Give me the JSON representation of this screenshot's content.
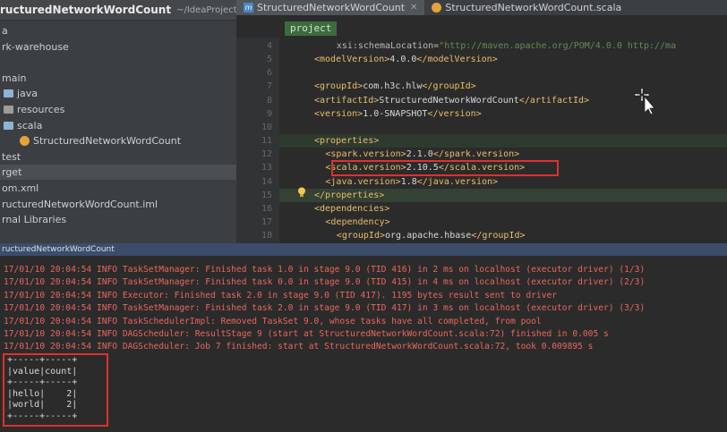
{
  "project": {
    "name": "ructuredNetworkWordCount",
    "path": "~/IdeaProjects/Stru",
    "items": [
      {
        "label": "a",
        "indent": 2
      },
      {
        "label": "rk-warehouse",
        "indent": 2
      },
      {
        "label": "",
        "indent": 2
      },
      {
        "label": "main",
        "indent": 2
      },
      {
        "label": "java",
        "indent": 4,
        "icon": "folder-icon"
      },
      {
        "label": "resources",
        "indent": 4,
        "icon": "resources-folder-icon"
      },
      {
        "label": "scala",
        "indent": 4,
        "icon": "folder-icon"
      },
      {
        "label": "StructuredNetworkWordCount",
        "indent": 22,
        "icon": "scala-object-icon"
      },
      {
        "label": "test",
        "indent": 2
      },
      {
        "label": "rget",
        "indent": 2,
        "selected": true
      },
      {
        "label": "om.xml",
        "indent": 2
      },
      {
        "label": "ructuredNetworkWordCount.iml",
        "indent": 2
      },
      {
        "label": "rnal Libraries",
        "indent": 2
      }
    ]
  },
  "tabs": [
    {
      "label": "StructuredNetworkWordCount",
      "icon": "maven-icon",
      "active": true
    },
    {
      "label": "StructuredNetworkWordCount.scala",
      "icon": "scala-file-icon",
      "active": false
    }
  ],
  "breadcrumb": "project",
  "code_lines": [
    {
      "num": "4",
      "indent": 4,
      "parts": [
        {
          "c": "attr",
          "t": "xsi:schemaLocation="
        },
        {
          "c": "str",
          "t": "\"http://maven.apache.org/POM/4.0.0 http://ma"
        }
      ]
    },
    {
      "num": "5",
      "indent": 0,
      "parts": [
        {
          "c": "tag",
          "t": "<modelVersion>"
        },
        {
          "c": "txt",
          "t": "4.0.0"
        },
        {
          "c": "tag",
          "t": "</modelVersion>"
        }
      ]
    },
    {
      "num": "6",
      "indent": 0,
      "parts": []
    },
    {
      "num": "7",
      "indent": 0,
      "parts": [
        {
          "c": "tag",
          "t": "<groupId>"
        },
        {
          "c": "txt",
          "t": "com.h3c.hlw"
        },
        {
          "c": "tag",
          "t": "</groupId>"
        }
      ]
    },
    {
      "num": "8",
      "indent": 0,
      "parts": [
        {
          "c": "tag",
          "t": "<artifactId>"
        },
        {
          "c": "txt",
          "t": "StructuredNetworkWordCount"
        },
        {
          "c": "tag",
          "t": "</artifactId>"
        }
      ]
    },
    {
      "num": "9",
      "indent": 0,
      "parts": [
        {
          "c": "tag",
          "t": "<version>"
        },
        {
          "c": "txt",
          "t": "1.0-SNAPSHOT"
        },
        {
          "c": "tag",
          "t": "</version>"
        }
      ]
    },
    {
      "num": "10",
      "indent": 0,
      "parts": []
    },
    {
      "num": "11",
      "indent": 0,
      "parts": [
        {
          "c": "tag",
          "t": "<properties>"
        }
      ]
    },
    {
      "num": "12",
      "indent": 2,
      "parts": [
        {
          "c": "tag",
          "t": "<spark.version>"
        },
        {
          "c": "txt",
          "t": "2.1.0"
        },
        {
          "c": "tag",
          "t": "</spark.version>"
        }
      ]
    },
    {
      "num": "13",
      "indent": 2,
      "parts": [
        {
          "c": "tag",
          "t": "<scala.version>"
        },
        {
          "c": "txt",
          "t": "2.10.5"
        },
        {
          "c": "tag",
          "t": "</scala.version>"
        }
      ]
    },
    {
      "num": "14",
      "indent": 2,
      "parts": [
        {
          "c": "tag",
          "t": "<java.version>"
        },
        {
          "c": "txt",
          "t": "1.8"
        },
        {
          "c": "tag",
          "t": "</java.version>"
        }
      ]
    },
    {
      "num": "15",
      "indent": 0,
      "parts": [
        {
          "c": "tag",
          "t": "</properties>"
        }
      ]
    },
    {
      "num": "16",
      "indent": 0,
      "parts": [
        {
          "c": "tag",
          "t": "<dependencies>"
        }
      ]
    },
    {
      "num": "17",
      "indent": 2,
      "parts": [
        {
          "c": "tag",
          "t": "<dependency>"
        }
      ]
    },
    {
      "num": "18",
      "indent": 4,
      "parts": [
        {
          "c": "tag",
          "t": "<groupId>"
        },
        {
          "c": "txt",
          "t": "org.apache.hbase"
        },
        {
          "c": "tag",
          "t": "</groupId>"
        }
      ]
    }
  ],
  "run_panel_title": "ructuredNetworkWordCount",
  "log_lines": [
    "17/01/10 20:04:54 INFO TaskSetManager: Finished task 1.0 in stage 9.0 (TID 416) in 2 ms on localhost (executor driver) (1/3)",
    "17/01/10 20:04:54 INFO TaskSetManager: Finished task 0.0 in stage 9.0 (TID 415) in 4 ms on localhost (executor driver) (2/3)",
    "17/01/10 20:04:54 INFO Executor: Finished task 2.0 in stage 9.0 (TID 417). 1195 bytes result sent to driver",
    "17/01/10 20:04:54 INFO TaskSetManager: Finished task 2.0 in stage 9.0 (TID 417) in 3 ms on localhost (executor driver) (3/3)",
    "17/01/10 20:04:54 INFO TaskSchedulerImpl: Removed TaskSet 9.0, whose tasks have all completed, from pool",
    "17/01/10 20:04:54 INFO DAGScheduler: ResultStage 9 (start at StructuredNetworkWordCount.scala:72) finished in 0.005 s",
    "17/01/10 20:04:54 INFO DAGScheduler: Job 7 finished: start at StructuredNetworkWordCount.scala:72, took 0.009895 s"
  ],
  "output_lines": [
    "+-----+-----+",
    "|value|count|",
    "+-----+-----+",
    "|hello|    2|",
    "|world|    2|",
    "+-----+-----+"
  ],
  "colors": {
    "log_text": "#e8675d",
    "highlight_border": "#e0302e"
  }
}
